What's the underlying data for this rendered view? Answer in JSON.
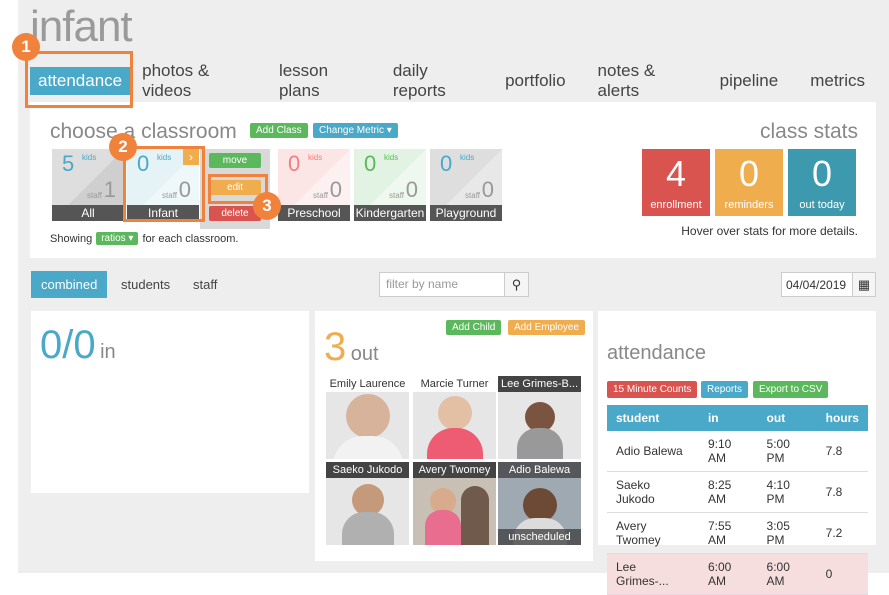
{
  "page": {
    "title": "infant"
  },
  "nav": [
    {
      "label": "attendance"
    },
    {
      "label": "photos & videos"
    },
    {
      "label": "lesson plans"
    },
    {
      "label": "daily reports"
    },
    {
      "label": "portfolio"
    },
    {
      "label": "notes & alerts"
    },
    {
      "label": "pipeline"
    },
    {
      "label": "metrics"
    }
  ],
  "callouts": [
    "1",
    "2",
    "3"
  ],
  "classroom": {
    "heading": "choose a classroom",
    "add_class": "Add Class",
    "change_metric": "Change Metric ▾",
    "tiles": [
      {
        "name": "All",
        "kids": "5",
        "staff": "1",
        "color": "#4aa8c9"
      },
      {
        "name": "Infant",
        "kids": "0",
        "staff": "0",
        "color": "#4aa8c9"
      },
      {
        "name": "Preschool",
        "kids": "0",
        "staff": "0",
        "color": "#f08080"
      },
      {
        "name": "Kindergarten",
        "kids": "0",
        "staff": "0",
        "color": "#5cb85c"
      },
      {
        "name": "Playground",
        "kids": "0",
        "staff": "0",
        "color": "#4aa8c9"
      }
    ],
    "kids_label": "kids",
    "staff_label": "staff",
    "menu": {
      "move": "move",
      "edit": "edit",
      "delete": "delete"
    },
    "showing_prefix": "Showing",
    "showing_select": "ratios ▾",
    "showing_suffix": "for each classroom."
  },
  "stats": {
    "heading": "class stats",
    "items": [
      {
        "num": "4",
        "label": "enrollment",
        "color": "#d9534f"
      },
      {
        "num": "0",
        "label": "reminders",
        "color": "#f0ad4e"
      },
      {
        "num": "0",
        "label": "out today",
        "color": "#3d9aae"
      }
    ],
    "hover_note": "Hover over stats for more details."
  },
  "tabs": [
    {
      "label": "combined"
    },
    {
      "label": "students"
    },
    {
      "label": "staff"
    }
  ],
  "filter": {
    "placeholder": "filter by name"
  },
  "date": {
    "value": "04/04/2019"
  },
  "in_card": {
    "count": "0/0",
    "label": "in"
  },
  "out_card": {
    "count": "3",
    "label": "out",
    "add_child": "Add Child",
    "add_employee": "Add Employee",
    "people": [
      {
        "name": "Emily Laurence",
        "style": "light"
      },
      {
        "name": "Marcie Turner",
        "style": "light"
      },
      {
        "name": "Lee Grimes-B...",
        "style": "dark"
      },
      {
        "name": "Saeko Jukodo",
        "style": "dark"
      },
      {
        "name": "Avery Twomey",
        "style": "dark"
      },
      {
        "name": "Adio Balewa",
        "style": "dark",
        "tag": "unscheduled"
      }
    ]
  },
  "attendance": {
    "heading": "attendance",
    "btn_15min": "15 Minute Counts",
    "btn_reports": "Reports",
    "btn_export": "Export to CSV",
    "columns": [
      "student",
      "in",
      "out",
      "hours"
    ],
    "rows": [
      {
        "student": "Adio Balewa",
        "in": "9:10 AM",
        "out": "5:00 PM",
        "hours": "7.8",
        "warn": false
      },
      {
        "student": "Saeko Jukodo",
        "in": "8:25 AM",
        "out": "4:10 PM",
        "hours": "7.8",
        "warn": false
      },
      {
        "student": "Avery Twomey",
        "in": "7:55 AM",
        "out": "3:05 PM",
        "hours": "7.2",
        "warn": false
      },
      {
        "student": "Lee Grimes-...",
        "in": "6:00 AM",
        "out": "6:00 AM",
        "hours": "0",
        "warn": true
      }
    ]
  }
}
